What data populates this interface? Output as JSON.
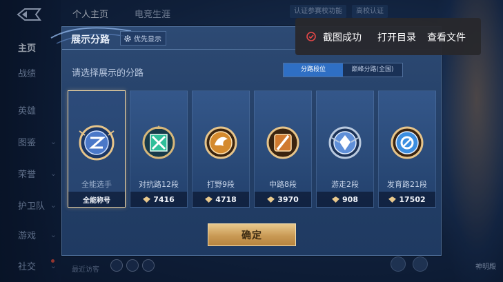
{
  "background": {
    "left_nav": {
      "items": [
        {
          "label": "主页",
          "active": true
        },
        {
          "label": "战绩"
        },
        {
          "label": "英雄"
        },
        {
          "label": "图鉴"
        },
        {
          "label": "荣誉"
        },
        {
          "label": "护卫队"
        },
        {
          "label": "游戏"
        },
        {
          "label": "社交"
        }
      ]
    },
    "top_tabs": [
      {
        "label": "个人主页",
        "active": true
      },
      {
        "label": "电竞生涯"
      }
    ],
    "top_pills": [
      {
        "label": "认证参赛校功能"
      },
      {
        "label": "高校认证"
      }
    ],
    "recent_label": "最近访客",
    "corner_label": "神明殿"
  },
  "dialog": {
    "title": "展示分路",
    "pref_button": "优先显示",
    "subtitle": "请选择展示的分路",
    "segments": [
      {
        "label": "分路段位",
        "active": true
      },
      {
        "label": "巅峰分路(全国)",
        "active": false
      }
    ],
    "cards": [
      {
        "name": "全能选手",
        "foot": "全能称号",
        "selected": true,
        "emblem_color": "#4a78c8"
      },
      {
        "name": "对抗路12段",
        "score": "7416",
        "emblem_color": "#2fbf9a"
      },
      {
        "name": "打野9段",
        "score": "4718",
        "emblem_color": "#d48a2e"
      },
      {
        "name": "中路8段",
        "score": "3970",
        "emblem_color": "#d07a30"
      },
      {
        "name": "游走2段",
        "score": "908",
        "emblem_color": "#5f8fd8"
      },
      {
        "name": "发育路21段",
        "score": "17502",
        "emblem_color": "#3c8ee0"
      }
    ],
    "confirm": "确定"
  },
  "toast": {
    "message": "截图成功",
    "action_open": "打开目录",
    "action_view": "查看文件",
    "check_color": "#e54848"
  },
  "colors": {
    "accent_gold": "#e9c98d",
    "segment_active": "#2f6fc4",
    "dialog_bg": "#2d4a74"
  }
}
